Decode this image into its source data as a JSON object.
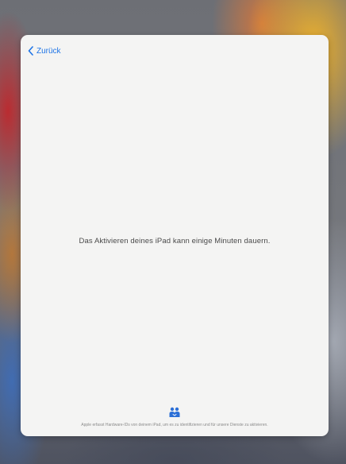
{
  "nav": {
    "back_label": "Zurück"
  },
  "main": {
    "message": "Das Aktivieren deines iPad kann einige Minuten dauern."
  },
  "footer": {
    "privacy_icon": "privacy-handshake-icon",
    "privacy_text": "Apple erfasst Hardware-IDs von deinem iPad, um es zu identifizieren und für unsere Dienste zu aktivieren."
  },
  "colors": {
    "accent": "#1e74e6",
    "sheet_background": "#f4f4f3"
  }
}
